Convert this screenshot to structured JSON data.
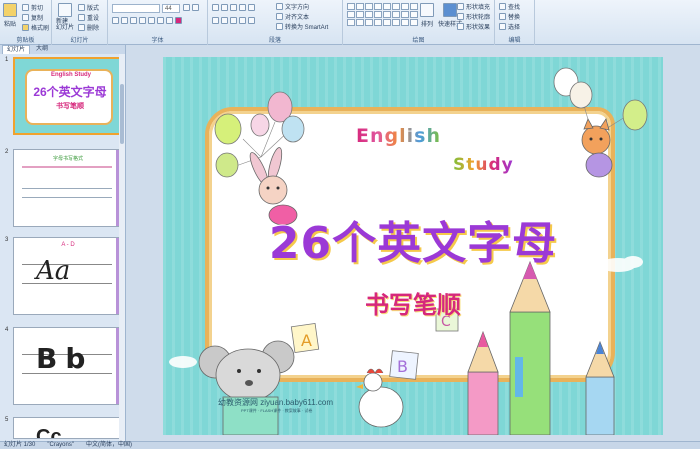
{
  "ribbon": {
    "clipboard": {
      "paste": "粘贴",
      "cut": "剪切",
      "copy": "复制",
      "format_painter": "格式刷",
      "label": "剪贴板"
    },
    "slides": {
      "new_slide": "新建\n幻灯片",
      "layout": "版式",
      "reset": "重设",
      "delete": "删除",
      "label": "幻灯片"
    },
    "font": {
      "font_name": "",
      "font_size": "44",
      "label": "字体"
    },
    "paragraph": {
      "text_direction": "文字方向",
      "align_text": "对齐文本",
      "smartart": "转换为 SmartArt",
      "label": "段落"
    },
    "drawing": {
      "arrange": "排列",
      "quick_styles": "快速样式",
      "fill": "形状填充",
      "outline": "形状轮廓",
      "effects": "形状效果",
      "label": "绘图"
    },
    "editing": {
      "find": "查找",
      "replace": "替换",
      "select": "选择",
      "label": "编辑"
    }
  },
  "leftpane": {
    "tabs": [
      "幻灯片",
      "大纲"
    ],
    "thumbs": [
      {
        "num": "1",
        "title": "26个英文字母",
        "subtitle": "书写笔顺",
        "eng": "English Study"
      },
      {
        "num": "2",
        "title": "字母书写格式",
        "subtitle": ""
      },
      {
        "num": "3",
        "title": "A - D",
        "letters": "Aa"
      },
      {
        "num": "4",
        "title": "",
        "letters": "Bb"
      },
      {
        "num": "5",
        "title": "",
        "letters": "Cc"
      }
    ]
  },
  "slide": {
    "english_1": "English",
    "english_2": "Study",
    "title": "26个英文字母",
    "subtitle": "书写笔顺",
    "footer": "幼教资源网 ziyuan.baby611.com",
    "footer_sub": "PPT课件 · FLASH课件 · 教案故事 · 试卷",
    "blocks": [
      "A",
      "B",
      "C"
    ]
  },
  "status": {
    "slide": "幻灯片 1/30",
    "theme": "\"Crayons\"",
    "lang": "中文(简体，中国)"
  }
}
